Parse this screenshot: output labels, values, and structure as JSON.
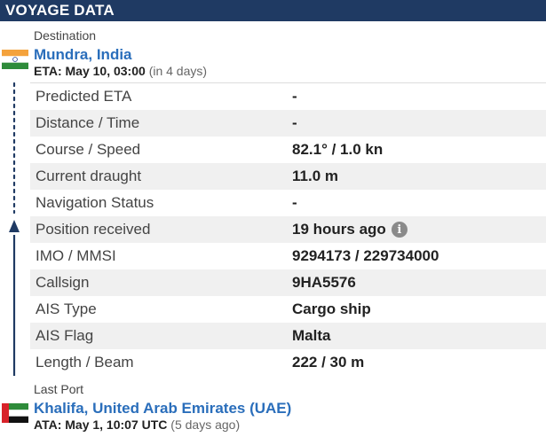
{
  "header": {
    "title": "VOYAGE DATA"
  },
  "destination": {
    "section_label": "Destination",
    "port": "Mundra, India",
    "eta_key": "ETA: May 10, 03:00",
    "eta_rel": "(in 4 days)",
    "flag": "india-flag"
  },
  "rows": [
    {
      "label": "Predicted ETA",
      "value": "-"
    },
    {
      "label": "Distance / Time",
      "value": "-"
    },
    {
      "label": "Course / Speed",
      "value": "82.1° / 1.0 kn"
    },
    {
      "label": "Current draught",
      "value": "11.0 m"
    },
    {
      "label": "Navigation Status",
      "value": "-"
    },
    {
      "label": "Position received",
      "value": "19 hours ago",
      "icon": "info-icon"
    },
    {
      "label": "IMO / MMSI",
      "value": "9294173 / 229734000"
    },
    {
      "label": "Callsign",
      "value": "9HA5576"
    },
    {
      "label": "AIS Type",
      "value": "Cargo ship"
    },
    {
      "label": "AIS Flag",
      "value": "Malta"
    },
    {
      "label": "Length / Beam",
      "value": "222 / 30 m"
    }
  ],
  "last_port": {
    "section_label": "Last Port",
    "port": "Khalifa, United Arab Emirates (UAE)",
    "ata_key": "ATA: May 1, 10:07 UTC",
    "ata_rel": "(5 days ago)",
    "flag": "uae-flag"
  },
  "colors": {
    "header_bg": "#1f3a63",
    "link": "#2a6ebb",
    "route": "#1f3a63"
  }
}
